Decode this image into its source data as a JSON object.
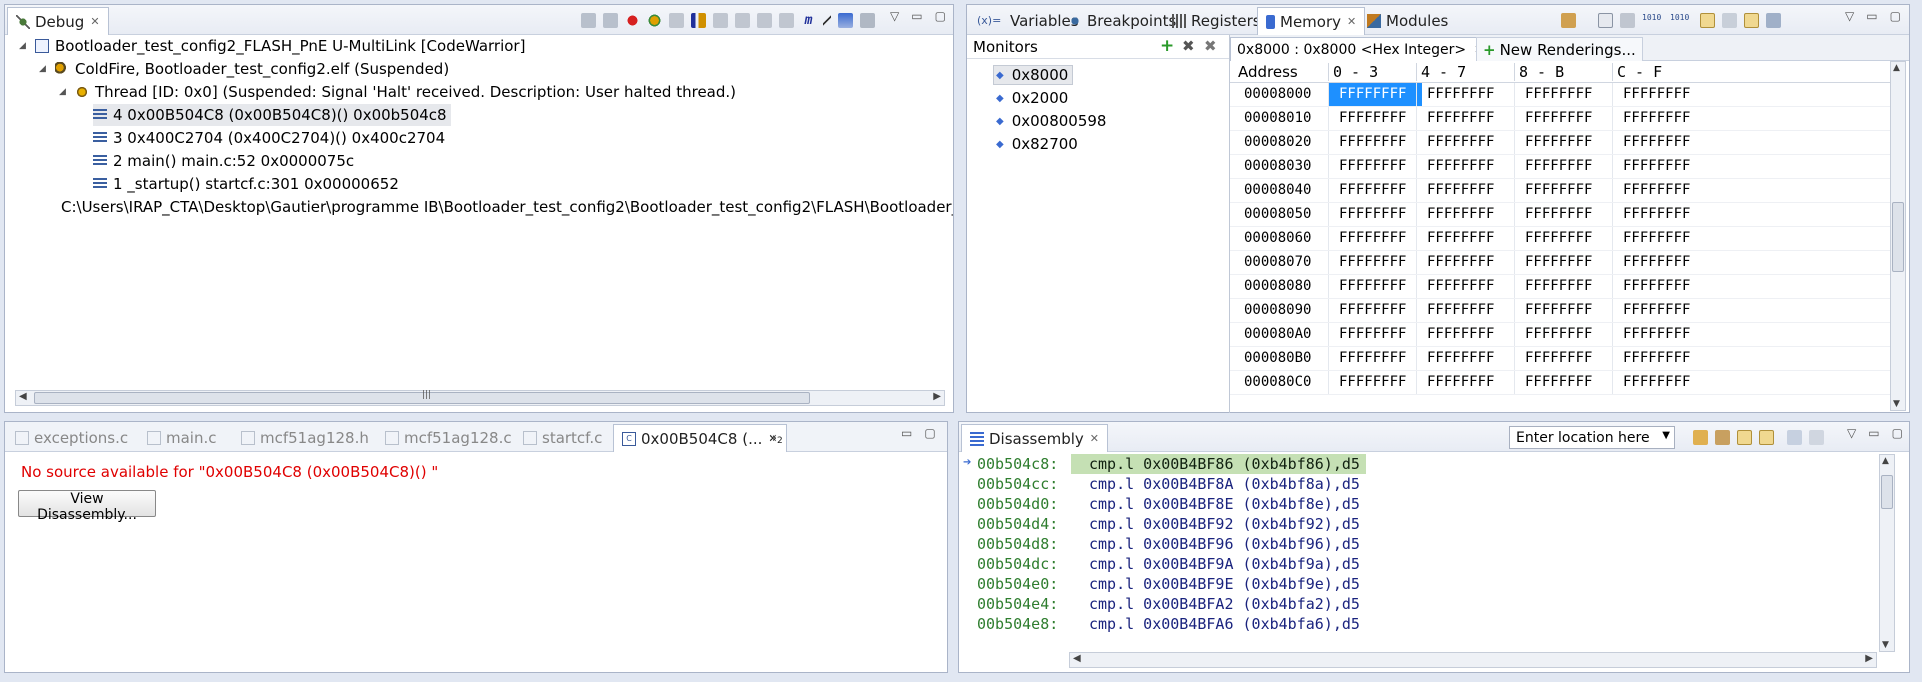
{
  "debug": {
    "tab_label": "Debug",
    "tree": [
      {
        "label": "Bootloader_test_config2_FLASH_PnE U-MultiLink [CodeWarrior]",
        "level": 0,
        "icon": "launch-config-icon"
      },
      {
        "label": "ColdFire, Bootloader_test_config2.elf (Suspended)",
        "level": 1,
        "icon": "debug-target-icon"
      },
      {
        "label": "Thread [ID: 0x0] (Suspended: Signal 'Halt' received. Description: User halted thread.)",
        "level": 2,
        "icon": "thread-icon"
      },
      {
        "label": "4 0x00B504C8 (0x00B504C8)()  0x00b504c8",
        "level": 3,
        "icon": "stack-frame-icon",
        "selected": true
      },
      {
        "label": "3 0x400C2704 (0x400C2704)()  0x400c2704",
        "level": 3,
        "icon": "stack-frame-icon"
      },
      {
        "label": "2 main() main.c:52 0x0000075c",
        "level": 3,
        "icon": "stack-frame-icon"
      },
      {
        "label": "1 _startup() startcf.c:301 0x00000652",
        "level": 3,
        "icon": "stack-frame-icon"
      },
      {
        "label": "C:\\Users\\IRAP_CTA\\Desktop\\Gautier\\programme IB\\Bootloader_test_config2\\Bootloader_test_config2\\FLASH\\Bootloader_test_confi",
        "level": 1,
        "icon": "process-icon"
      }
    ]
  },
  "right_tabs": {
    "variables": "Variables",
    "breakpoints": "Breakpoints",
    "registers": "Registers",
    "memory": "Memory",
    "modules": "Modules"
  },
  "monitors": {
    "title": "Monitors",
    "items": [
      "0x8000",
      "0x2000",
      "0x00800598",
      "0x82700"
    ]
  },
  "memory": {
    "rendering_tab": "0x8000 : 0x8000 <Hex Integer>",
    "new_renderings": "New Renderings...",
    "headers": [
      "Address",
      "0 - 3",
      "4 - 7",
      "8 - B",
      "C - F"
    ],
    "rows": [
      {
        "addr": "00008000",
        "cells": [
          "FFFFFFFF",
          "FFFFFFFF",
          "FFFFFFFF",
          "FFFFFFFF"
        ]
      },
      {
        "addr": "00008010",
        "cells": [
          "FFFFFFFF",
          "FFFFFFFF",
          "FFFFFFFF",
          "FFFFFFFF"
        ]
      },
      {
        "addr": "00008020",
        "cells": [
          "FFFFFFFF",
          "FFFFFFFF",
          "FFFFFFFF",
          "FFFFFFFF"
        ]
      },
      {
        "addr": "00008030",
        "cells": [
          "FFFFFFFF",
          "FFFFFFFF",
          "FFFFFFFF",
          "FFFFFFFF"
        ]
      },
      {
        "addr": "00008040",
        "cells": [
          "FFFFFFFF",
          "FFFFFFFF",
          "FFFFFFFF",
          "FFFFFFFF"
        ]
      },
      {
        "addr": "00008050",
        "cells": [
          "FFFFFFFF",
          "FFFFFFFF",
          "FFFFFFFF",
          "FFFFFFFF"
        ]
      },
      {
        "addr": "00008060",
        "cells": [
          "FFFFFFFF",
          "FFFFFFFF",
          "FFFFFFFF",
          "FFFFFFFF"
        ]
      },
      {
        "addr": "00008070",
        "cells": [
          "FFFFFFFF",
          "FFFFFFFF",
          "FFFFFFFF",
          "FFFFFFFF"
        ]
      },
      {
        "addr": "00008080",
        "cells": [
          "FFFFFFFF",
          "FFFFFFFF",
          "FFFFFFFF",
          "FFFFFFFF"
        ]
      },
      {
        "addr": "00008090",
        "cells": [
          "FFFFFFFF",
          "FFFFFFFF",
          "FFFFFFFF",
          "FFFFFFFF"
        ]
      },
      {
        "addr": "000080A0",
        "cells": [
          "FFFFFFFF",
          "FFFFFFFF",
          "FFFFFFFF",
          "FFFFFFFF"
        ]
      },
      {
        "addr": "000080B0",
        "cells": [
          "FFFFFFFF",
          "FFFFFFFF",
          "FFFFFFFF",
          "FFFFFFFF"
        ]
      },
      {
        "addr": "000080C0",
        "cells": [
          "FFFFFFFF",
          "FFFFFFFF",
          "FFFFFFFF",
          "FFFFFFFF"
        ]
      }
    ]
  },
  "editor": {
    "tabs": [
      "exceptions.c",
      "main.c",
      "mcf51ag128.h",
      "mcf51ag128.c",
      "startcf.c",
      "0x00B504C8 (..."
    ],
    "overflow_label": "»",
    "overflow_count": "2",
    "no_source_message": "No source available for \"0x00B504C8 (0x00B504C8)() \"",
    "view_disassembly_label": "View Disassembly..."
  },
  "disassembly": {
    "tab_label": "Disassembly",
    "location_placeholder": "Enter location here",
    "rows": [
      {
        "addr": "00b504c8:",
        "instr": "cmp.l 0x00B4BF86 (0xb4bf86),d5",
        "current": true
      },
      {
        "addr": "00b504cc:",
        "instr": "cmp.l 0x00B4BF8A (0xb4bf8a),d5"
      },
      {
        "addr": "00b504d0:",
        "instr": "cmp.l 0x00B4BF8E (0xb4bf8e),d5"
      },
      {
        "addr": "00b504d4:",
        "instr": "cmp.l 0x00B4BF92 (0xb4bf92),d5"
      },
      {
        "addr": "00b504d8:",
        "instr": "cmp.l 0x00B4BF96 (0xb4bf96),d5"
      },
      {
        "addr": "00b504dc:",
        "instr": "cmp.l 0x00B4BF9A (0xb4bf9a),d5"
      },
      {
        "addr": "00b504e0:",
        "instr": "cmp.l 0x00B4BF9E (0xb4bf9e),d5"
      },
      {
        "addr": "00b504e4:",
        "instr": "cmp.l 0x00B4BFA2 (0xb4bfa2),d5"
      },
      {
        "addr": "00b504e8:",
        "instr": "cmp.l 0x00B4BFA6 (0xb4bfa6),d5"
      }
    ]
  },
  "colors": {
    "selection": "#1e90ff",
    "addr_green": "#2e7d2e",
    "instr_blue": "#1a237e",
    "error_red": "#e00000",
    "current_line": "#c5e0b4"
  }
}
